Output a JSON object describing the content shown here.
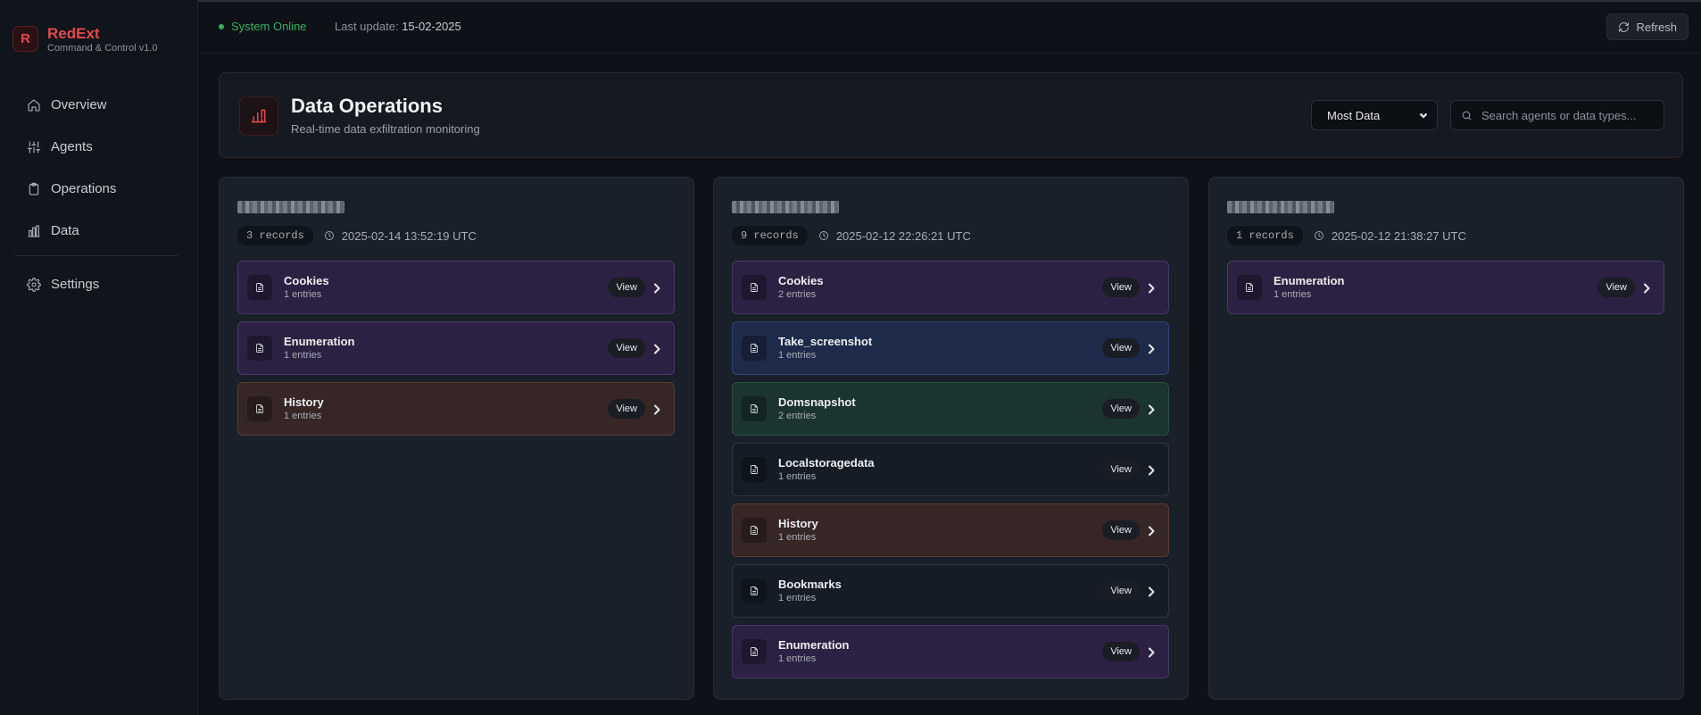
{
  "brand": {
    "logo_letter": "R",
    "name": "RedExt",
    "subtitle": "Command & Control v1.0"
  },
  "nav": {
    "items": [
      {
        "label": "Overview",
        "icon": "home-icon"
      },
      {
        "label": "Agents",
        "icon": "sliders-icon"
      },
      {
        "label": "Operations",
        "icon": "clipboard-icon"
      },
      {
        "label": "Data",
        "icon": "bar-chart-icon"
      }
    ],
    "settings": {
      "label": "Settings",
      "icon": "gear-icon"
    }
  },
  "header": {
    "status": "System Online",
    "last_update_label": "Last update:",
    "last_update_value": "15-02-2025",
    "refresh_label": "Refresh"
  },
  "panel": {
    "title": "Data Operations",
    "subtitle": "Real-time data exfiltration monitoring",
    "sort_value": "Most Data",
    "search_placeholder": "Search agents or data types..."
  },
  "colors": {
    "accent": "#e5484d",
    "online": "#34b25e"
  },
  "agents": [
    {
      "records": "3 records",
      "timestamp": "2025-02-14 13:52:19 UTC",
      "items": [
        {
          "title": "Cookies",
          "sub": "1 entries",
          "tone": "purple"
        },
        {
          "title": "Enumeration",
          "sub": "1 entries",
          "tone": "purple"
        },
        {
          "title": "History",
          "sub": "1 entries",
          "tone": "brown"
        }
      ]
    },
    {
      "records": "9 records",
      "timestamp": "2025-02-12 22:26:21 UTC",
      "items": [
        {
          "title": "Cookies",
          "sub": "2 entries",
          "tone": "purple"
        },
        {
          "title": "Take_screenshot",
          "sub": "1 entries",
          "tone": "blue"
        },
        {
          "title": "Domsnapshot",
          "sub": "2 entries",
          "tone": "green"
        },
        {
          "title": "Localstoragedata",
          "sub": "1 entries",
          "tone": "slate"
        },
        {
          "title": "History",
          "sub": "1 entries",
          "tone": "brown"
        },
        {
          "title": "Bookmarks",
          "sub": "1 entries",
          "tone": "slate"
        },
        {
          "title": "Enumeration",
          "sub": "1 entries",
          "tone": "purple"
        }
      ]
    },
    {
      "records": "1 records",
      "timestamp": "2025-02-12 21:38:27 UTC",
      "items": [
        {
          "title": "Enumeration",
          "sub": "1 entries",
          "tone": "purple"
        }
      ]
    }
  ],
  "view_label": "View"
}
